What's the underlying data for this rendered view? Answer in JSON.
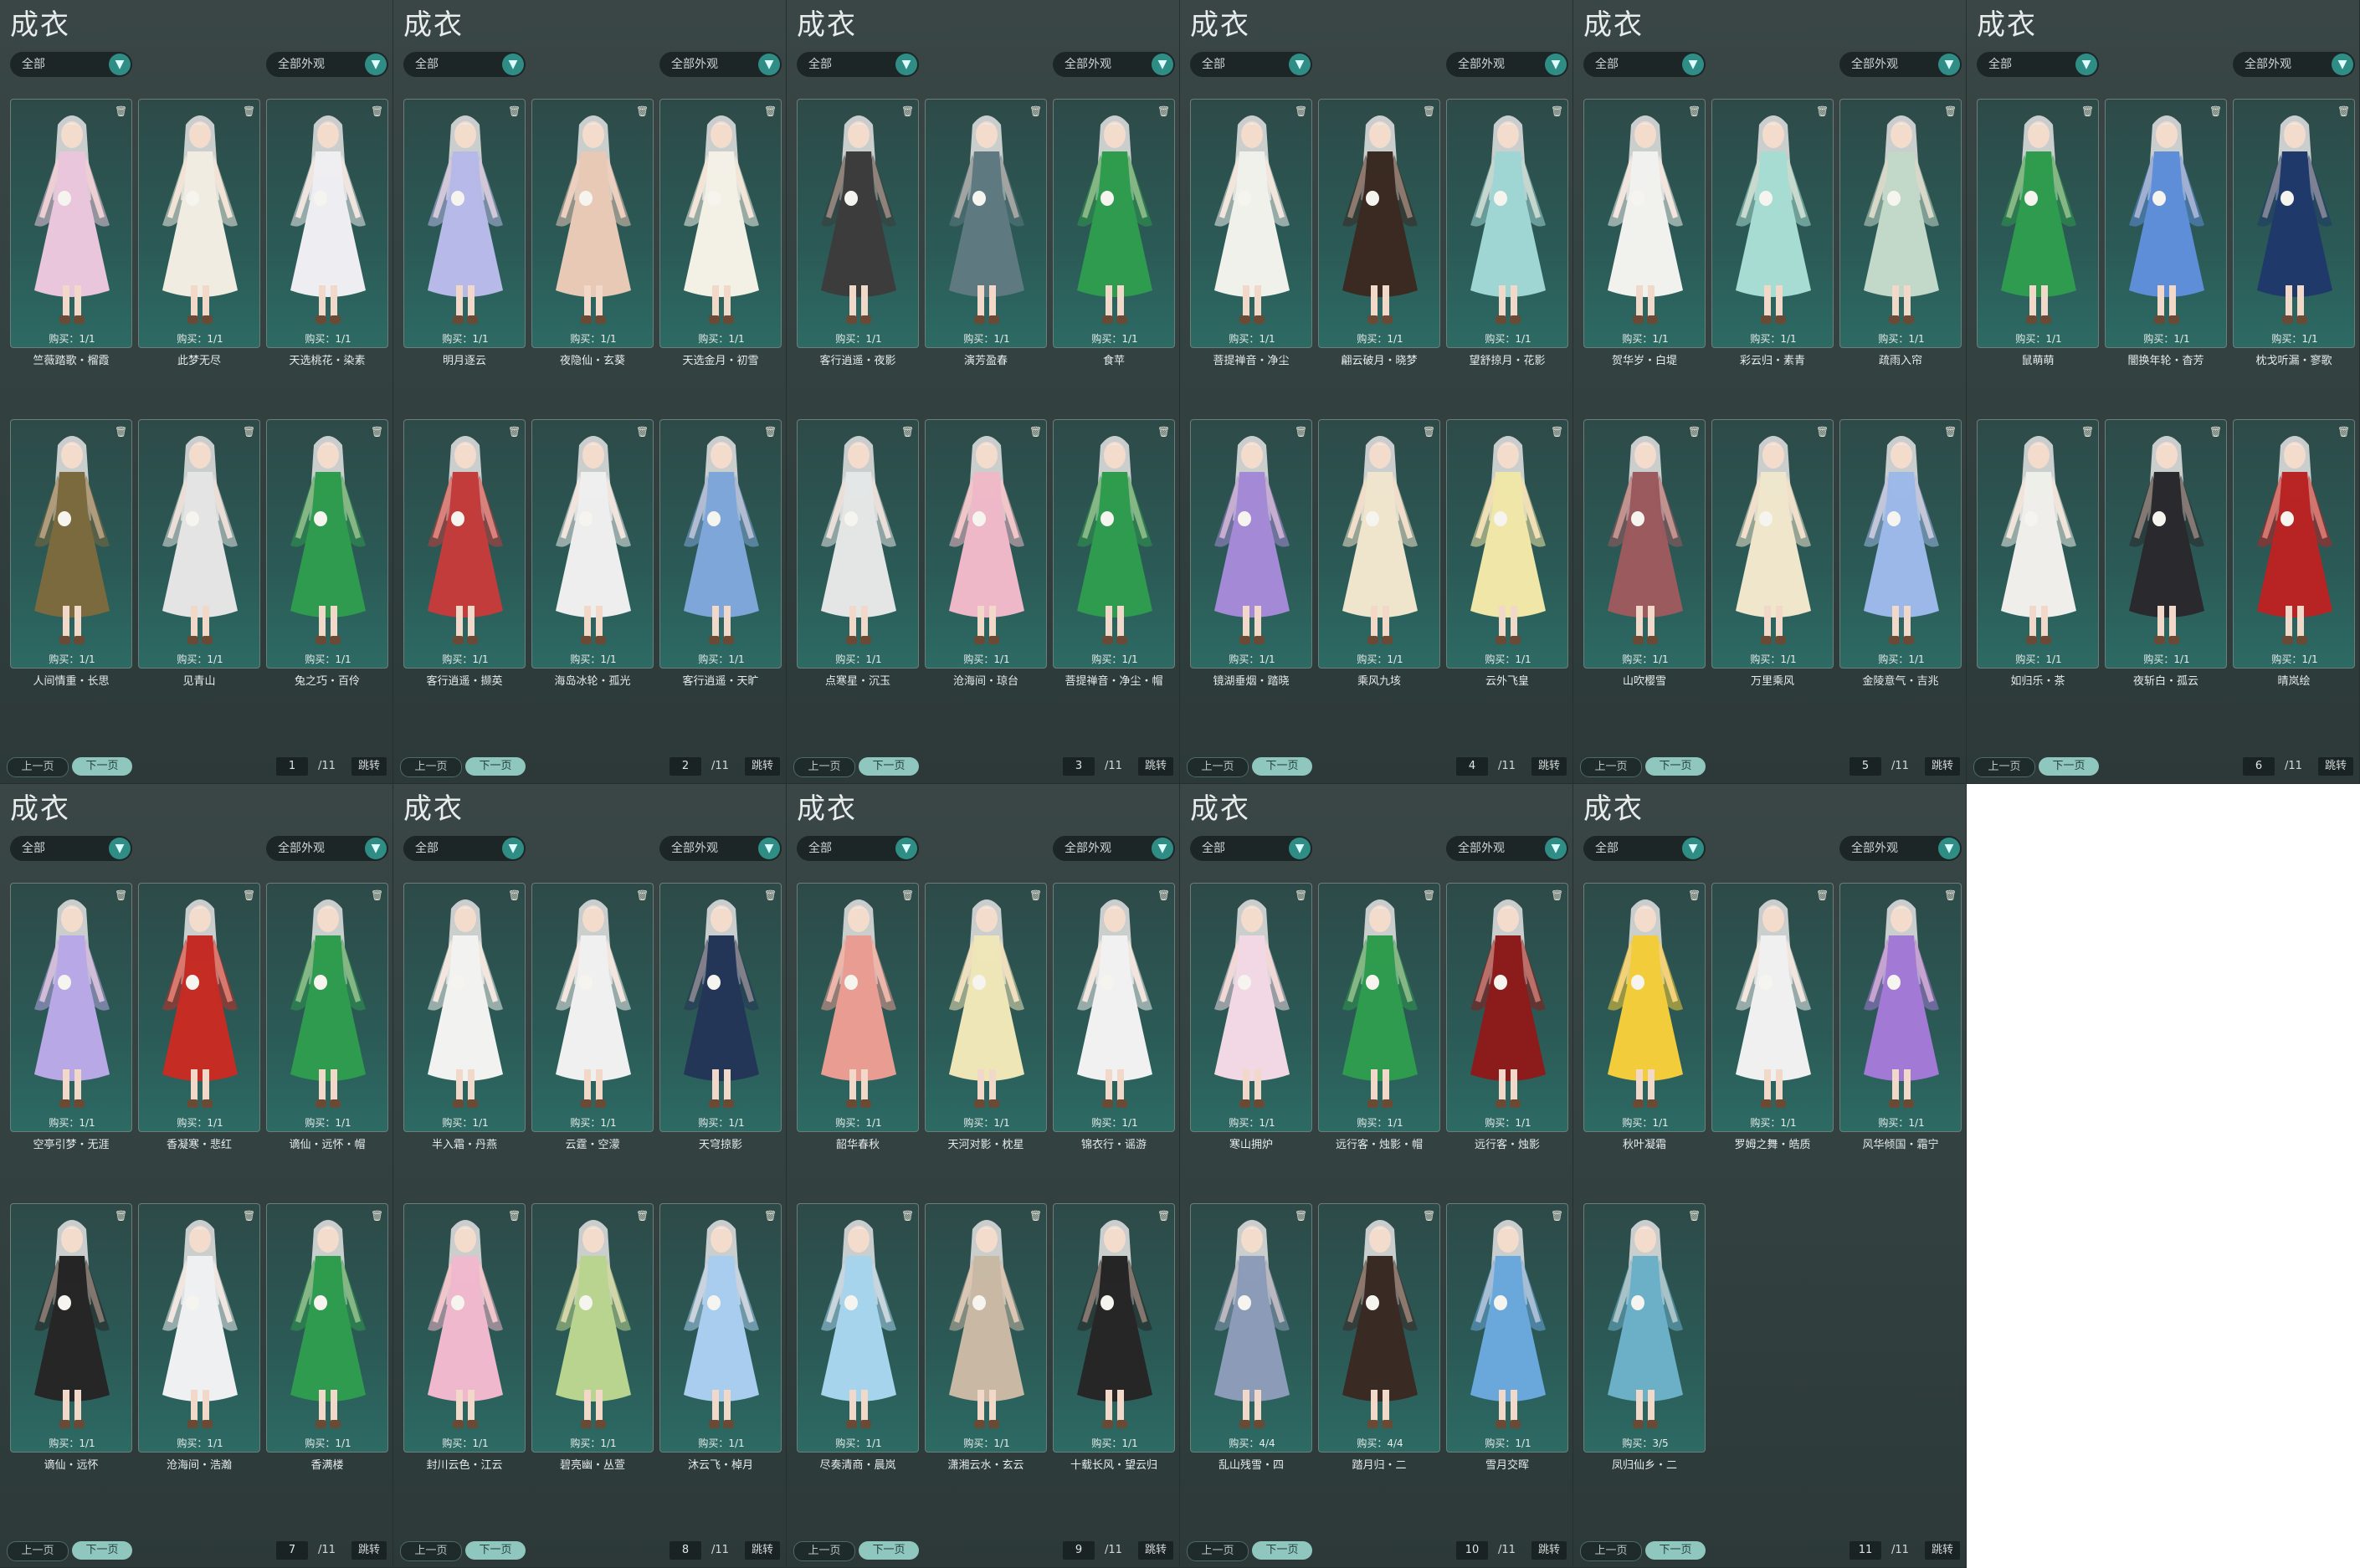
{
  "panel_title": "成衣",
  "filter_all": "全部",
  "filter_appearance": "全部外观",
  "dropdown_arrow": "▼",
  "prev_label": "上一页",
  "next_label": "下一页",
  "jump_label": "跳转",
  "lock_icon": "trash-icon",
  "panels": [
    {
      "page": "1",
      "total": "/11",
      "items": [
        {
          "buy": "购买：1/1",
          "name": "竺薇踏歌・榴霞",
          "color": "#e9c6dc"
        },
        {
          "buy": "购买：1/1",
          "name": "此梦无尽",
          "color": "#f1ece2"
        },
        {
          "buy": "购买：1/1",
          "name": "天选桃花・染素",
          "color": "#eeeef2"
        },
        {
          "buy": "购买：1/1",
          "name": "人间情重・长思",
          "color": "#7a6a3e"
        },
        {
          "buy": "购买：1/1",
          "name": "见青山",
          "color": "#e4e4e4"
        },
        {
          "buy": "购买：1/1",
          "name": "兔之巧・百伶",
          "color": "#2f9b4e"
        }
      ]
    },
    {
      "page": "2",
      "total": "/11",
      "items": [
        {
          "buy": "购买：1/1",
          "name": "明月逐云",
          "color": "#b7b9e8"
        },
        {
          "buy": "购买：1/1",
          "name": "夜隐仙・玄葵",
          "color": "#e8c9b6"
        },
        {
          "buy": "购买：1/1",
          "name": "天选金月・初雪",
          "color": "#f3f0e6"
        },
        {
          "buy": "购买：1/1",
          "name": "客行逍遥・撷英",
          "color": "#c23c3c"
        },
        {
          "buy": "购买：1/1",
          "name": "海岛冰轮・孤光",
          "color": "#eeeeee"
        },
        {
          "buy": "购买：1/1",
          "name": "客行逍遥・天旷",
          "color": "#7ea6d8"
        }
      ]
    },
    {
      "page": "3",
      "total": "/11",
      "items": [
        {
          "buy": "购买：1/1",
          "name": "客行逍遥・夜影",
          "color": "#3c3c3c"
        },
        {
          "buy": "购买：1/1",
          "name": "演芳盈春",
          "color": "#5e7a80"
        },
        {
          "buy": "购买：1/1",
          "name": "食苹",
          "color": "#2f9b4e"
        },
        {
          "buy": "购买：1/1",
          "name": "点寒星・沉玉",
          "color": "#e4e6e6"
        },
        {
          "buy": "购买：1/1",
          "name": "沧海间・琼台",
          "color": "#eeb8c8"
        },
        {
          "buy": "购买：1/1",
          "name": "菩提禅音・净尘・帽",
          "color": "#2f9b4e"
        }
      ]
    },
    {
      "page": "4",
      "total": "/11",
      "items": [
        {
          "buy": "购买：1/1",
          "name": "菩提禅音・净尘",
          "color": "#f1f1ec"
        },
        {
          "buy": "购买：1/1",
          "name": "翩云破月・晓梦",
          "color": "#3a2a22"
        },
        {
          "buy": "购买：1/1",
          "name": "望舒掠月・花影",
          "color": "#9fd6d4"
        },
        {
          "buy": "购买：1/1",
          "name": "镜湖垂烟・踏晓",
          "color": "#a48ad6"
        },
        {
          "buy": "购买：1/1",
          "name": "乘风九垓",
          "color": "#efe4cc"
        },
        {
          "buy": "购买：1/1",
          "name": "云外飞皇",
          "color": "#efe6a8"
        }
      ]
    },
    {
      "page": "5",
      "total": "/11",
      "items": [
        {
          "buy": "购买：1/1",
          "name": "贺华岁・白堤",
          "color": "#f1f1ee"
        },
        {
          "buy": "购买：1/1",
          "name": "彩云归・素青",
          "color": "#a6dcd2"
        },
        {
          "buy": "购买：1/1",
          "name": "疏雨入帘",
          "color": "#c2d8c8"
        },
        {
          "buy": "购买：1/1",
          "name": "山吹樱雪",
          "color": "#9a5a5e"
        },
        {
          "buy": "购买：1/1",
          "name": "万里乘风",
          "color": "#efe6cc"
        },
        {
          "buy": "购买：1/1",
          "name": "金陵意气・吉兆",
          "color": "#9cb8e8"
        }
      ]
    },
    {
      "page": "6",
      "total": "/11",
      "items": [
        {
          "buy": "购买：1/1",
          "name": "鼠萌萌",
          "color": "#2f9b4e"
        },
        {
          "buy": "购买：1/1",
          "name": "闇换年轮・杳芳",
          "color": "#5e8ed8"
        },
        {
          "buy": "购买：1/1",
          "name": "枕戈听漏・寥歌",
          "color": "#1f3a6a"
        },
        {
          "buy": "购买：1/1",
          "name": "如归乐・茶",
          "color": "#efeeea"
        },
        {
          "buy": "购买：1/1",
          "name": "夜斩白・孤云",
          "color": "#2a2a2e"
        },
        {
          "buy": "购买：1/1",
          "name": "晴岚绘",
          "color": "#b82424"
        }
      ]
    },
    {
      "page": "7",
      "total": "/11",
      "items": [
        {
          "buy": "购买：1/1",
          "name": "空亭引梦・无涯",
          "color": "#b8a8e6"
        },
        {
          "buy": "购买：1/1",
          "name": "香凝寒・悲红",
          "color": "#c42c24"
        },
        {
          "buy": "购买：1/1",
          "name": "谪仙・远怀・帽",
          "color": "#2f9b4e"
        },
        {
          "buy": "购买：1/1",
          "name": "谪仙・远怀",
          "color": "#262626"
        },
        {
          "buy": "购买：1/1",
          "name": "沧海间・浩瀚",
          "color": "#eef0f2"
        },
        {
          "buy": "购买：1/1",
          "name": "香满楼",
          "color": "#2f9b4e"
        }
      ]
    },
    {
      "page": "8",
      "total": "/11",
      "items": [
        {
          "buy": "购买：1/1",
          "name": "半入霜・丹燕",
          "color": "#f2f2f0"
        },
        {
          "buy": "购买：1/1",
          "name": "云霆・空濛",
          "color": "#f0f0f0"
        },
        {
          "buy": "购买：1/1",
          "name": "天穹掠影",
          "color": "#243658"
        },
        {
          "buy": "购买：1/1",
          "name": "封川云色・江云",
          "color": "#f0b8cc"
        },
        {
          "buy": "购买：1/1",
          "name": "碧亮幽・丛萱",
          "color": "#b8d48e"
        },
        {
          "buy": "购买：1/1",
          "name": "沐云飞・棹月",
          "color": "#a8cdef"
        }
      ]
    },
    {
      "page": "9",
      "total": "/11",
      "items": [
        {
          "buy": "购买：1/1",
          "name": "韶华春秋",
          "color": "#e89c92"
        },
        {
          "buy": "购买：1/1",
          "name": "天河对影・枕星",
          "color": "#efe6b8"
        },
        {
          "buy": "购买：1/1",
          "name": "锦衣行・谣游",
          "color": "#f1f1f1"
        },
        {
          "buy": "购买：1/1",
          "name": "尽奏清商・晨岚",
          "color": "#a6d4ec"
        },
        {
          "buy": "购买：1/1",
          "name": "潇湘云水・玄云",
          "color": "#c8b8a4"
        },
        {
          "buy": "购买：1/1",
          "name": "十载长风・望云归",
          "color": "#262626"
        }
      ]
    },
    {
      "page": "10",
      "total": "/11",
      "items": [
        {
          "buy": "购买：1/1",
          "name": "寒山拥炉",
          "color": "#f1d8e4"
        },
        {
          "buy": "购买：1/1",
          "name": "远行客・烛影・帽",
          "color": "#2f9b4e"
        },
        {
          "buy": "购买：1/1",
          "name": "远行客・烛影",
          "color": "#8c1c1c"
        },
        {
          "buy": "购买：4/4",
          "name": "乱山残雪・四",
          "color": "#8c9cb8"
        },
        {
          "buy": "购买：4/4",
          "name": "踏月归・二",
          "color": "#3a2a24"
        },
        {
          "buy": "购买：1/1",
          "name": "雪月交晖",
          "color": "#6aa8dc"
        }
      ]
    },
    {
      "page": "11",
      "total": "/11",
      "items": [
        {
          "buy": "购买：1/1",
          "name": "秋叶凝霜",
          "color": "#f2cc3a"
        },
        {
          "buy": "购买：1/1",
          "name": "罗姆之舞・皓质",
          "color": "#f0f0f0"
        },
        {
          "buy": "购买：1/1",
          "name": "风华倾国・霜宁",
          "color": "#a27ad6"
        },
        {
          "buy": "购买：3/5",
          "name": "凤归仙乡・二",
          "color": "#6cb0c8"
        }
      ]
    }
  ]
}
